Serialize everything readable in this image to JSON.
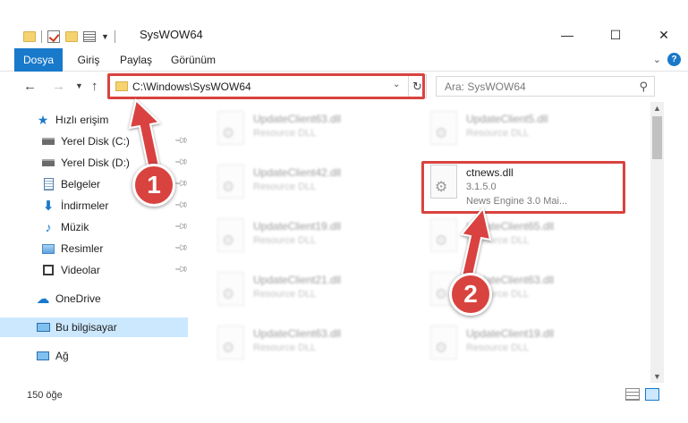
{
  "window": {
    "title": "SysWOW64",
    "minimize": "—",
    "maximize": "☐",
    "close": "✕"
  },
  "ribbon": {
    "tabs": [
      {
        "label": "Dosya",
        "active": true
      },
      {
        "label": "Giriş",
        "active": false
      },
      {
        "label": "Paylaş",
        "active": false
      },
      {
        "label": "Görünüm",
        "active": false
      }
    ],
    "help": "?"
  },
  "address": {
    "path": "C:\\Windows\\SysWOW64",
    "search_placeholder": "Ara: SysWOW64"
  },
  "sidebar": {
    "items": [
      {
        "label": "Hızlı erişim",
        "icon": "star-icon",
        "pinned": false
      },
      {
        "label": "Yerel Disk (C:)",
        "icon": "drive-icon",
        "pinned": true
      },
      {
        "label": "Yerel Disk (D:)",
        "icon": "drive-icon",
        "pinned": true
      },
      {
        "label": "Belgeler",
        "icon": "documents-icon",
        "pinned": true
      },
      {
        "label": "İndirmeler",
        "icon": "download-icon",
        "pinned": true
      },
      {
        "label": "Müzik",
        "icon": "music-icon",
        "pinned": true
      },
      {
        "label": "Resimler",
        "icon": "pictures-icon",
        "pinned": true
      },
      {
        "label": "Videolar",
        "icon": "videos-icon",
        "pinned": true
      },
      {
        "label": "OneDrive",
        "icon": "cloud-icon",
        "pinned": false
      },
      {
        "label": "Bu bilgisayar",
        "icon": "computer-icon",
        "pinned": false,
        "selected": true
      },
      {
        "label": "Ağ",
        "icon": "network-icon",
        "pinned": false
      }
    ]
  },
  "files": {
    "blurred": [
      {
        "name": "UpdateClient63.dll",
        "type": "Resource DLL"
      },
      {
        "name": "UpdateClient5.dll",
        "type": "Resource DLL"
      },
      {
        "name": "UpdateClient42.dll",
        "type": "Resource DLL"
      },
      {
        "name": "UpdateClient19.dll",
        "type": "Resource DLL"
      },
      {
        "name": "UpdateClient65.dll",
        "type": "Resource DLL"
      },
      {
        "name": "UpdateClient21.dll",
        "type": "Resource DLL"
      },
      {
        "name": "UpdateClient63.dll",
        "type": "Resource DLL"
      },
      {
        "name": "UpdateClient63.dll",
        "type": "Resource DLL"
      },
      {
        "name": "UpdateClient19.dll",
        "type": "Resource DLL"
      }
    ],
    "highlighted": {
      "name": "ctnews.dll",
      "version": "3.1.5.0",
      "description": "News Engine 3.0 Mai..."
    }
  },
  "status": {
    "item_count": "150 öğe"
  },
  "markers": {
    "one": "1",
    "two": "2"
  },
  "colors": {
    "accent": "#1979ca",
    "highlight": "#d9433f",
    "selection": "#cce8ff"
  }
}
